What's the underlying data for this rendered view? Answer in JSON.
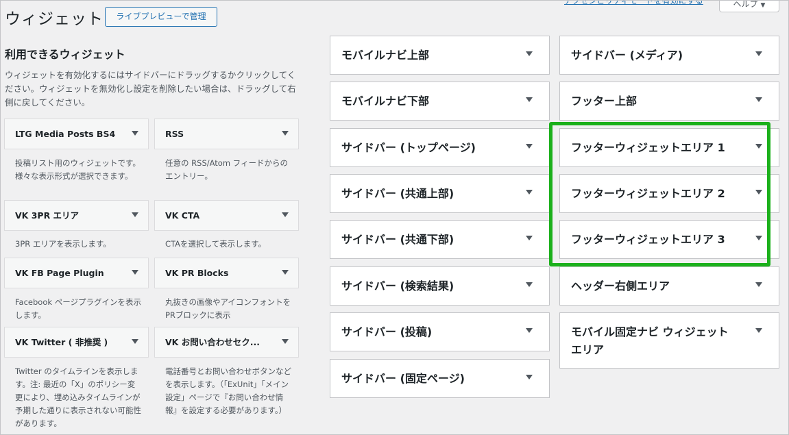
{
  "header": {
    "title": "ウィジェット",
    "manage_button": "ライブプレビューで管理",
    "accessibility_link": "アクセシビリティモードを有効にする",
    "help_button": "ヘルプ"
  },
  "available": {
    "title": "利用できるウィジェット",
    "description": "ウィジェットを有効化するにはサイドバーにドラッグするかクリックしてください。ウィジェットを無効化し設定を削除したい場合は、ドラッグして右側に戻してください。",
    "widgets": [
      {
        "title": "LTG Media Posts BS4",
        "desc": "投稿リスト用のウィジェットです。様々な表示形式が選択できます。"
      },
      {
        "title": "RSS",
        "desc": "任意の RSS/Atom フィードからのエントリー。"
      },
      {
        "title": "VK 3PR エリア",
        "desc": "3PR エリアを表示します。"
      },
      {
        "title": "VK CTA",
        "desc": "CTAを選択して表示します。"
      },
      {
        "title": "VK FB Page Plugin",
        "desc": "Facebook ページプラグインを表示します。"
      },
      {
        "title": "VK PR Blocks",
        "desc": "丸抜きの画像やアイコンフォントをPRブロックに表示"
      },
      {
        "title": "VK Twitter ( 非推奨 )",
        "desc": "Twitter のタイムラインを表示します。注: 最近の「X」のポリシー変更により、埋め込みタイムラインが予期した通りに表示されない可能性があります。"
      },
      {
        "title": "VK お問い合わせセク...",
        "desc": "電話番号とお問い合わせボタンなどを表示します。（「ExUnit」「メイン設定」ページで『お問い合わせ情報』を設定する必要があります。）"
      }
    ]
  },
  "sidebars_left": [
    "モバイルナビ上部",
    "モバイルナビ下部",
    "サイドバー (トップページ)",
    "サイドバー (共通上部)",
    "サイドバー (共通下部)",
    "サイドバー (検索結果)",
    "サイドバー (投稿)",
    "サイドバー (固定ページ)"
  ],
  "sidebars_right": [
    "サイドバー (メディア)",
    "フッター上部",
    "フッターウィジェットエリア 1",
    "フッターウィジェットエリア 2",
    "フッターウィジェットエリア 3",
    "ヘッダー右側エリア",
    "モバイル固定ナビ ウィジェットエリア"
  ],
  "colors": {
    "highlight": "#1bb01b",
    "link": "#2271b1"
  }
}
